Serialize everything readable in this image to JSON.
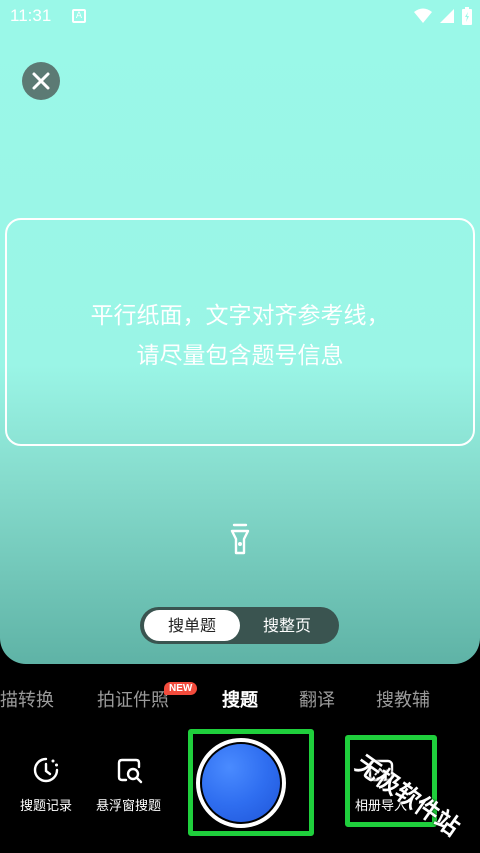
{
  "status_bar": {
    "time": "11:31",
    "notification_icon": "a-letter-icon",
    "icons": [
      "wifi-icon",
      "signal-icon",
      "battery-icon"
    ]
  },
  "camera": {
    "close_icon": "close-icon",
    "hint_line1": "平行纸面，文字对齐参考线，",
    "hint_line2": "请尽量包含题号信息",
    "flash_icon": "flashlight-icon",
    "toggle": {
      "single": "搜单题",
      "page": "搜整页",
      "selected": "single"
    }
  },
  "modes": {
    "items": [
      "描转换",
      "拍证件照",
      "搜题",
      "翻译",
      "搜教辅"
    ],
    "active_index": 2,
    "new_badge": "NEW"
  },
  "tools": {
    "history": {
      "label": "搜题记录",
      "icon": "clock-icon"
    },
    "float": {
      "label": "悬浮窗搜题",
      "icon": "float-search-icon"
    },
    "album": {
      "label": "相册导入",
      "icon": "album-icon"
    }
  },
  "watermark": "无极软件站",
  "colors": {
    "accent_blue": "#2f6ef0",
    "highlight_green": "#1fcf3c",
    "badge_red": "#f24b3c",
    "camera_bg": "#9af8e8"
  }
}
